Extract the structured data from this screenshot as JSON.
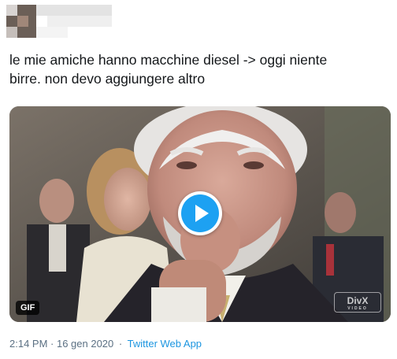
{
  "tweet": {
    "text": "le mie amiche hanno macchine diesel -> oggi niente\nbirre. non devo aggiungere altro",
    "media": {
      "badge": "GIF",
      "watermark": "DivX",
      "watermark_sub": "VIDEO",
      "play_icon": "play-icon"
    },
    "timestamp": "2:14 PM · 16 gen 2020",
    "separator": "·",
    "source": "Twitter Web App"
  },
  "header": {
    "avatar_state": "pixelated",
    "name_state": "pixelated"
  },
  "colors": {
    "accent": "#1da1f2",
    "link": "#1b95e0",
    "meta_text": "#5b7083"
  }
}
